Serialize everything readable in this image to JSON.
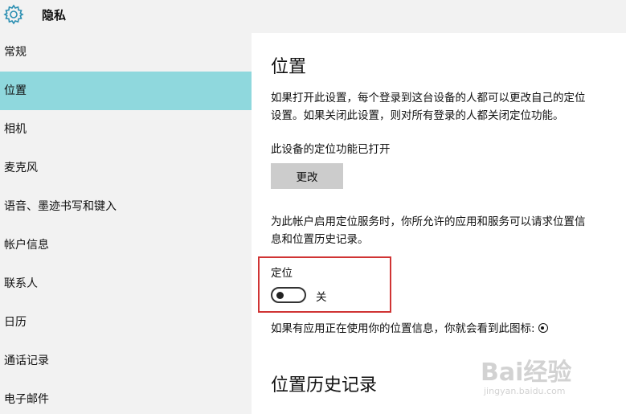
{
  "window": {
    "title": "隐私",
    "icon": "gear-icon"
  },
  "sidebar": {
    "items": [
      {
        "label": "常规"
      },
      {
        "label": "位置",
        "selected": true
      },
      {
        "label": "相机"
      },
      {
        "label": "麦克风"
      },
      {
        "label": "语音、墨迹书写和键入"
      },
      {
        "label": "帐户信息"
      },
      {
        "label": "联系人"
      },
      {
        "label": "日历"
      },
      {
        "label": "通话记录"
      },
      {
        "label": "电子邮件"
      }
    ]
  },
  "main": {
    "heading": "位置",
    "description_line1": "如果打开此设置，每个登录到这台设备的人都可以更改自己的定位",
    "description_line2": "设置。如果关闭此设置，则对所有登录的人都关闭定位功能。",
    "device_status": "此设备的定位功能已打开",
    "change_button": "更改",
    "account_text_line1": "为此帐户启用定位服务时，你所允许的应用和服务可以请求位置信",
    "account_text_line2": "息和位置历史记录。",
    "location_label": "定位",
    "toggle_state": "关",
    "toggle_on": false,
    "in_use_text": "如果有应用正在使用你的位置信息，你就会看到此图标:",
    "in_use_icon": "location-in-use-icon",
    "history_heading": "位置历史记录"
  },
  "watermark": {
    "brand": "Bai经验",
    "url": "jingyan.baidu.com"
  },
  "colors": {
    "selected_nav": "#8fd8dd",
    "highlight_box": "#d03434",
    "button_bg": "#cccccc",
    "sidebar_bg": "#f2f2f2"
  }
}
